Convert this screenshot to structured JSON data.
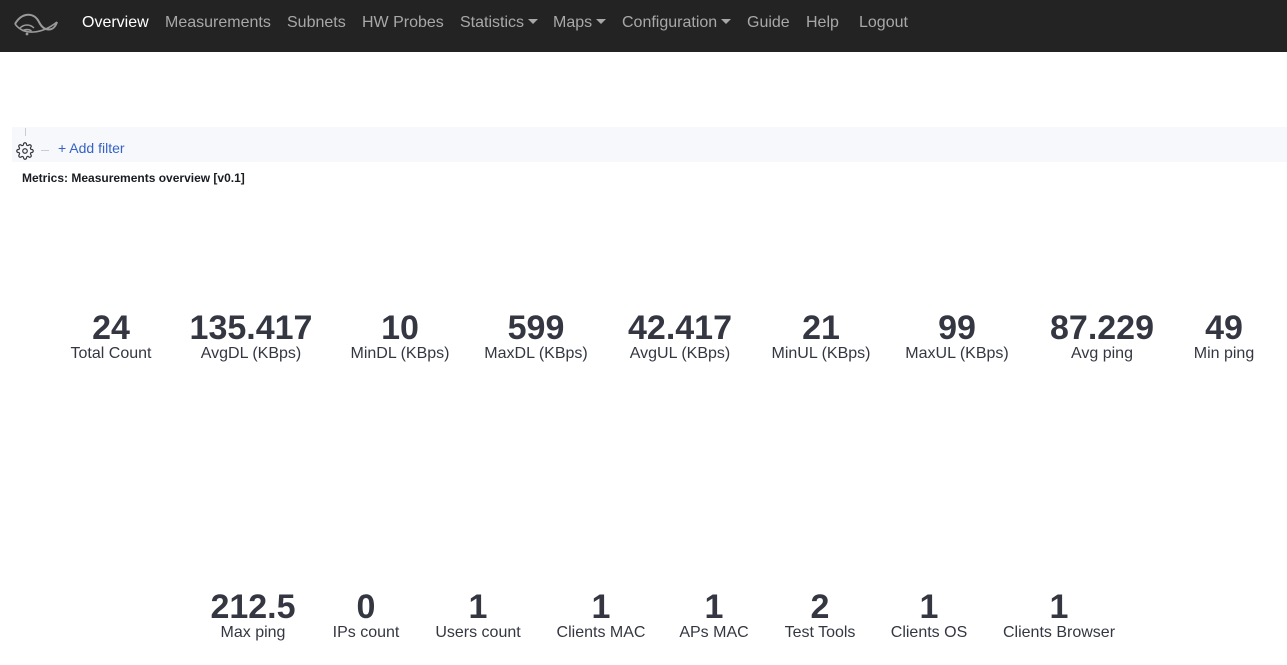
{
  "nav": {
    "items": [
      {
        "label": "Overview",
        "active": true,
        "dropdown": false
      },
      {
        "label": "Measurements",
        "active": false,
        "dropdown": false
      },
      {
        "label": "Subnets",
        "active": false,
        "dropdown": false
      },
      {
        "label": "HW Probes",
        "active": false,
        "dropdown": false
      },
      {
        "label": "Statistics",
        "active": false,
        "dropdown": true
      },
      {
        "label": "Maps",
        "active": false,
        "dropdown": true
      },
      {
        "label": "Configuration",
        "active": false,
        "dropdown": true
      },
      {
        "label": "Guide",
        "active": false,
        "dropdown": false
      },
      {
        "label": "Help",
        "active": false,
        "dropdown": false
      },
      {
        "label": "Logout",
        "active": false,
        "dropdown": false
      }
    ]
  },
  "filter": {
    "add_label": "+ Add filter"
  },
  "panel": {
    "title": "Metrics: Measurements overview [v0.1]"
  },
  "metrics": {
    "row1": [
      {
        "value": "24",
        "label": "Total Count"
      },
      {
        "value": "135.417",
        "label": "AvgDL (KBps)"
      },
      {
        "value": "10",
        "label": "MinDL (KBps)"
      },
      {
        "value": "599",
        "label": "MaxDL (KBps)"
      },
      {
        "value": "42.417",
        "label": "AvgUL (KBps)"
      },
      {
        "value": "21",
        "label": "MinUL (KBps)"
      },
      {
        "value": "99",
        "label": "MaxUL (KBps)"
      },
      {
        "value": "87.229",
        "label": "Avg ping"
      },
      {
        "value": "49",
        "label": "Min ping"
      }
    ],
    "row2": [
      {
        "value": "212.5",
        "label": "Max ping"
      },
      {
        "value": "0",
        "label": "IPs count"
      },
      {
        "value": "1",
        "label": "Users count"
      },
      {
        "value": "1",
        "label": "Clients MAC"
      },
      {
        "value": "1",
        "label": "APs MAC"
      },
      {
        "value": "2",
        "label": "Test Tools"
      },
      {
        "value": "1",
        "label": "Clients OS"
      },
      {
        "value": "1",
        "label": "Clients Browser"
      }
    ]
  },
  "colors": {
    "navbar_bg": "#232323",
    "nav_active": "#ffffff",
    "nav_inactive": "#a8a8a8",
    "link": "#3562c4",
    "metric_text": "#343741"
  }
}
